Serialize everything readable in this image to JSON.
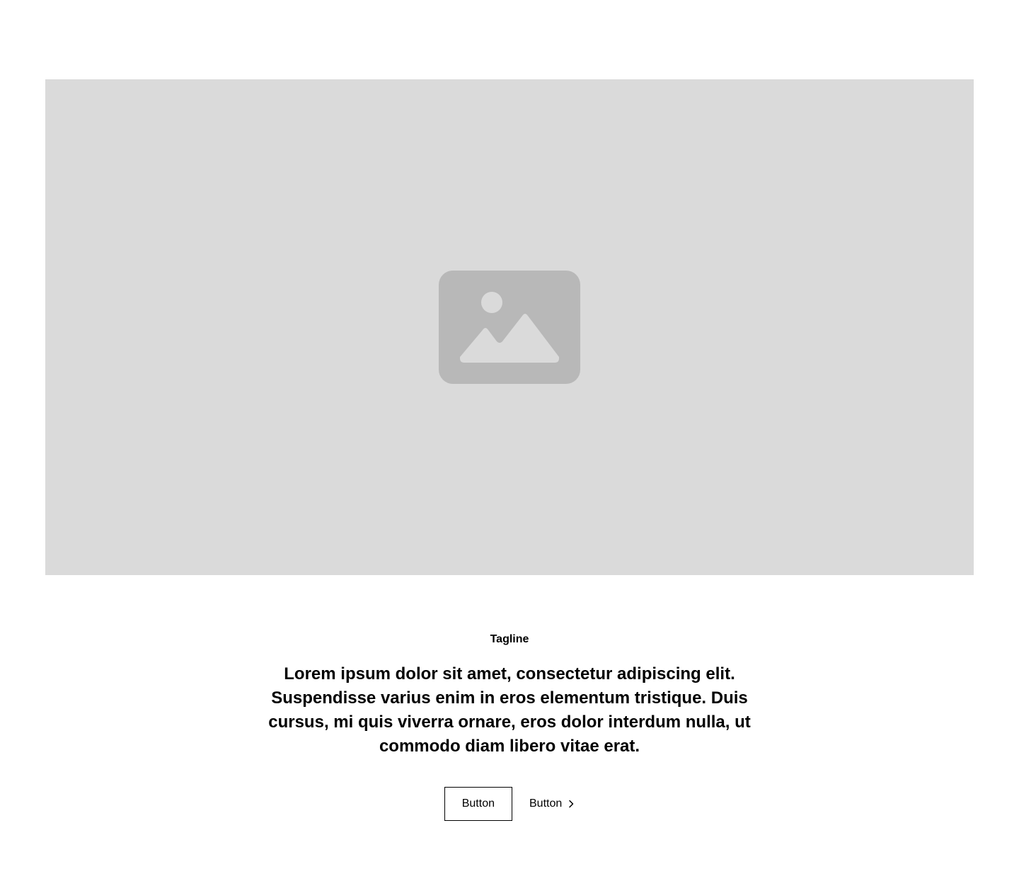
{
  "hero": {
    "image_icon": "image-placeholder-icon",
    "background_color": "#dadada",
    "icon_color": "#b8b8b8"
  },
  "content": {
    "tagline": "Tagline",
    "headline": "Lorem ipsum dolor sit amet, consectetur adipiscing elit. Suspendisse varius enim in eros elementum tristique. Duis cursus, mi quis viverra ornare, eros dolor interdum nulla, ut commodo diam libero vitae erat."
  },
  "actions": {
    "primary_label": "Button",
    "secondary_label": "Button",
    "secondary_icon": "chevron-right-icon"
  }
}
